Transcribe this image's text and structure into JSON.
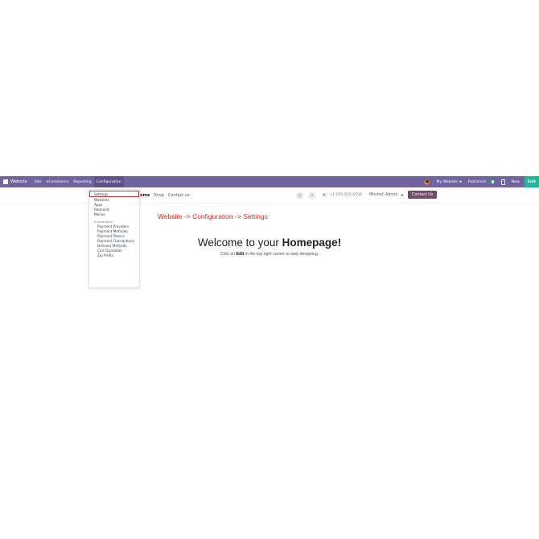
{
  "topbar": {
    "brand": "Website",
    "menu": [
      "Site",
      "eCommerce",
      "Reporting",
      "Configuration"
    ],
    "active_menu": "Configuration",
    "website_label": "My Website",
    "published_label": "Published",
    "new_label": "New",
    "edit_label": "Edit"
  },
  "sitenav": {
    "home_label": "Home",
    "shop_label": "Shop",
    "contact_label": "Contact us",
    "phone": "+1 555-555-5556",
    "user_name": "Mitchell Admin",
    "contact_button": "Contact Us"
  },
  "dropdown": {
    "items": [
      "Settings",
      "Websites",
      "Apps",
      "Redirects",
      "Menus"
    ],
    "section_header": "eCommerce",
    "sub_items": [
      "Payment Providers",
      "Payment Methods",
      "Payment Tokens",
      "Payment Transactions",
      "Delivery Methods",
      "Cart Quotation",
      "Zip Prefix"
    ]
  },
  "annotation": "Website -> Configuration -> Settings",
  "page": {
    "welcome_prefix": "Welcome to your ",
    "welcome_bold": "Homepage!",
    "tagline_before": "Click on ",
    "tagline_bold": "Edit",
    "tagline_after": " in the top right corner to start designing."
  },
  "colors": {
    "topbar_bg": "#71639e",
    "edit_button_bg": "#21b799",
    "contact_button_bg": "#714b67",
    "annotation_red": "#e8231b",
    "published_toggle": "#28a745"
  }
}
